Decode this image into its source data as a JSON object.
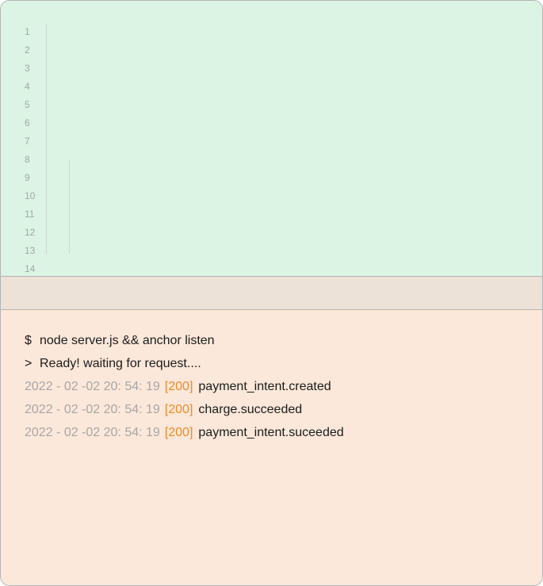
{
  "editor": {
    "line_numbers": [
      "1",
      "2",
      "3",
      "4",
      "5",
      "6",
      "7",
      "8",
      "9",
      "10",
      "11",
      "12",
      "13",
      "14"
    ]
  },
  "terminal": {
    "command": {
      "symbol": "$",
      "text": "node server.js && anchor listen"
    },
    "ready": {
      "symbol": ">",
      "text": "Ready! waiting for request...."
    },
    "logs": [
      {
        "timestamp": "2022 - 02 -02  20: 54: 19",
        "status": "[200]",
        "event": "payment_intent.created"
      },
      {
        "timestamp": "2022 - 02 -02  20: 54: 19",
        "status": "[200]",
        "event": "charge.succeeded"
      },
      {
        "timestamp": "2022 - 02 -02  20: 54: 19",
        "status": "[200]",
        "event": "payment_intent.suceeded"
      }
    ]
  },
  "colors": {
    "editor_bg": "#dcf4e4",
    "divider_bg": "#ede2d7",
    "terminal_bg": "#fce8da",
    "status_accent": "#f08a24",
    "timestamp": "#a6a6a6"
  }
}
